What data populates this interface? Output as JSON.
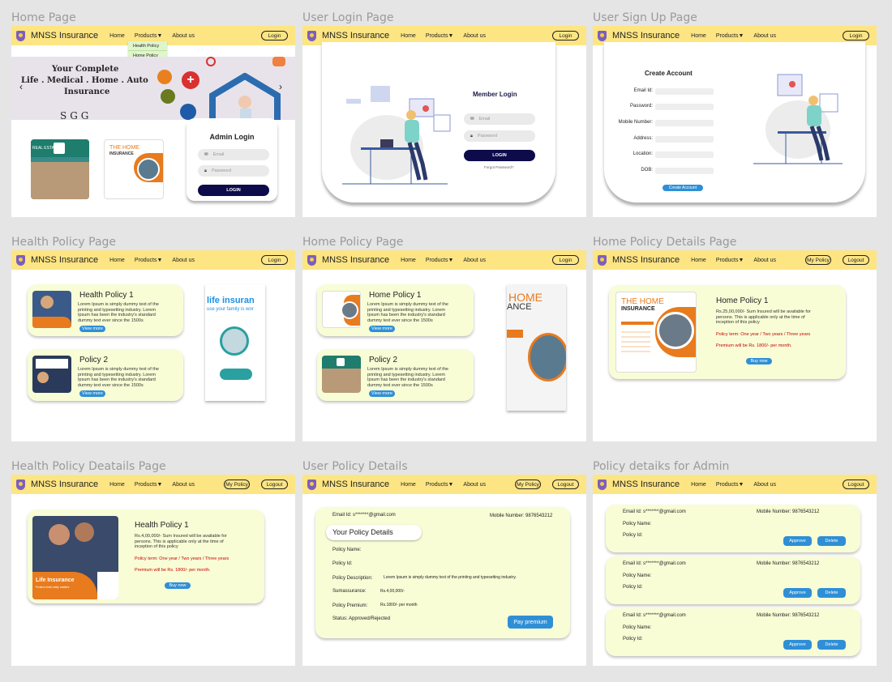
{
  "titles": [
    "Home Page",
    "User Login Page",
    "User Sign Up Page",
    "Health Policy Page",
    "Home Policy Page",
    "Home Policy Details Page",
    "Health Policy Deatails Page",
    "User Policy Details",
    "Policy detaiks for Admin"
  ],
  "nav": {
    "brand": "MNSS Insurance",
    "home": "Home",
    "products": "Products▼",
    "about": "About us",
    "login": "Login",
    "logout": "Logout",
    "mypolicy": "My Policy"
  },
  "dropdown": [
    "Health Policy",
    "Home Policy"
  ],
  "home": {
    "banner_line1": "Your Complete",
    "banner_line2": "Life . Medical . Home . Auto",
    "banner_line3": "Insurance",
    "banner_logo": "SGG",
    "ad1_label": "REAL ESTATE",
    "ad2_title": "THE HOME",
    "ad2_sub": "INSURANCE",
    "admin_title": "Admin Login",
    "email": "Email",
    "password": "Password",
    "login_btn": "LOGIN"
  },
  "login": {
    "title": "Member Login",
    "email": "Email",
    "password": "Password",
    "btn": "LOGIN",
    "forgot": "Forgot Password?"
  },
  "signup": {
    "title": "Create Account",
    "fields": [
      "Email Id:",
      "Password:",
      "Mobile Number:",
      "Address:",
      "Location:",
      "DOB:"
    ],
    "btn": "Create Account"
  },
  "policies": {
    "health1": "Health Policy 1",
    "p2": "Policy 2",
    "home1": "Home Policy 1",
    "lorem": "Lorem Ipsum is simply dummy text of the printing and typesetting industry. Lorem Ipsum has been the industry's standard dummy text ever since the 1500s",
    "view": "View more",
    "side_health": "life insuran",
    "side_health2": "use your family is wor",
    "side_home": "HOME",
    "side_home2": "ANCE"
  },
  "home_details": {
    "title": "Home Policy 1",
    "desc": "Rs.25,00,000/- Sum Insured will be available for persons. This is applicable only at the time of inception of this policy",
    "term": "Policy term: One year / Two years / Three years",
    "premium": "Premium will be Rs. 1800/- per month.",
    "buy": "Buy now",
    "img_title": "THE HOME",
    "img_sub": "INSURANCE"
  },
  "health_details": {
    "title": "Health Policy 1",
    "desc": "Rs.4,00,000/- Sum Insured will be available for persons. This is applicable only at the time of inception of this policy",
    "term": "Policy term: One year / Two years / Three years",
    "premium": "Premium will be Rs. 1800/- per month.",
    "buy": "Buy now",
    "img_title": "Life Insurance",
    "img_sub": "Protect what really matters"
  },
  "user_policy": {
    "email": "Email Id: s*******@gmail.com",
    "mobile": "Mobile Number: 9876543212",
    "title": "Your Policy Details",
    "name": "Policy Name:",
    "id": "Policy Id:",
    "desc_label": "Policy Description:",
    "desc": "Lorem Ipsum is simply dummy text of the printing and typesetting industry.",
    "sum_label": "Sumassurance:",
    "sum": "Rs.4,00,000/-",
    "prem_label": "Policy Premium:",
    "prem": "Rs.1800/- per month",
    "status": "Status: Approved/Rejected",
    "pay": "Pay premium"
  },
  "admin": {
    "email": "Email Id: s*******@gmail.com",
    "mobile": "Mobile Number: 9876543212",
    "name": "Policy Name:",
    "id": "Policy Id:",
    "approve": "Approve",
    "delete": "Delete"
  }
}
